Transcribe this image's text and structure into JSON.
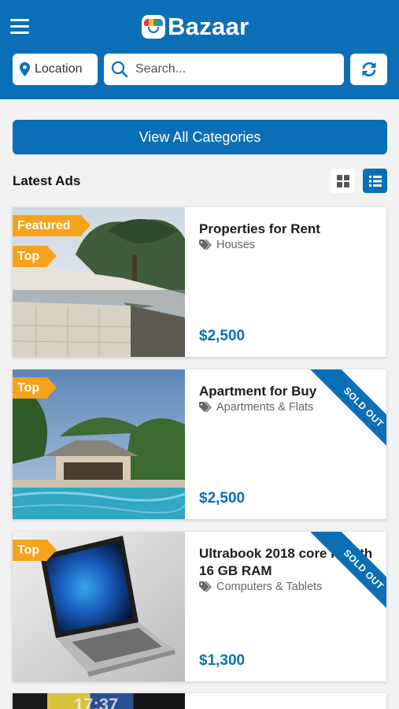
{
  "header": {
    "brand": "Bazaar",
    "location_label": "Location",
    "search_placeholder": "Search...",
    "colors": {
      "primary": "#0a6fb7",
      "accent": "#f7a21b"
    }
  },
  "categories_button": "View All Categories",
  "section_title": "Latest Ads",
  "icons": [
    "menu-icon",
    "location-pin-icon",
    "search-icon",
    "refresh-icon",
    "grid-view-icon",
    "list-view-icon",
    "tag-icon"
  ],
  "ads": [
    {
      "title": "Properties for Rent",
      "category": "Houses",
      "price": "$2,500",
      "badges": [
        "Featured",
        "Top"
      ],
      "sold_out": ""
    },
    {
      "title": "Apartment for Buy",
      "category": "Apartments & Flats",
      "price": "$2,500",
      "badges": [
        "Top"
      ],
      "sold_out": "SOLD OUT"
    },
    {
      "title": "Ultrabook 2018 core i7 with 16 GB RAM",
      "category": "Computers & Tablets",
      "price": "$1,300",
      "badges": [
        "Top"
      ],
      "sold_out": "SOLD OUT"
    }
  ],
  "partial_ad": {
    "thumb_text": "17:37"
  }
}
